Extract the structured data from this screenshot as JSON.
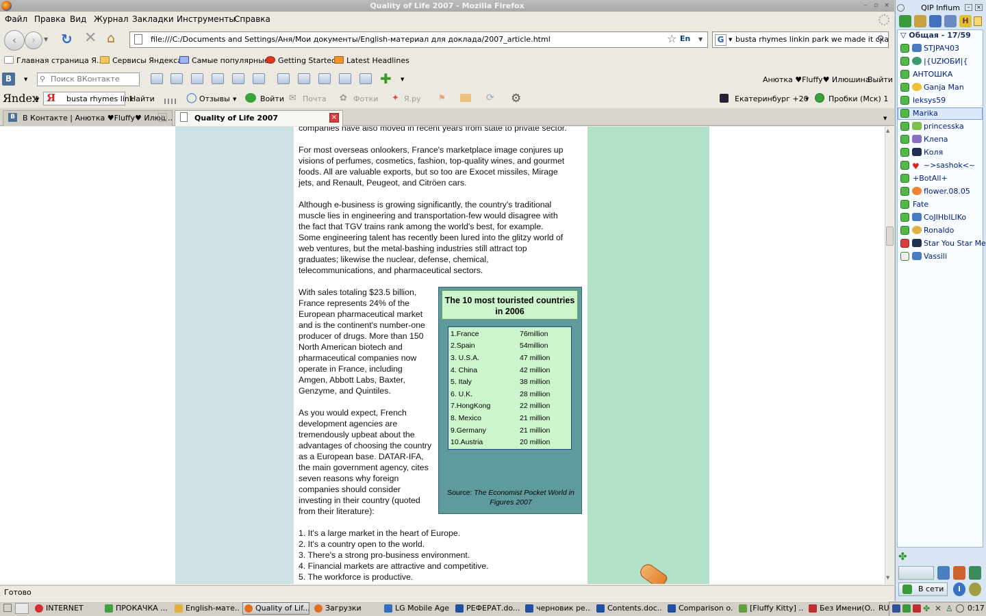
{
  "window": {
    "title": "Quality of Life 2007 - Mozilla Firefox"
  },
  "menu": [
    "Файл",
    "Правка",
    "Вид",
    "Журнал",
    "Закладки",
    "Инструменты",
    "Справка"
  ],
  "nav": {
    "url": "file:///C:/Documents and Settings/Аня/Мои документы/English-материал для доклада/2007_article.html",
    "lang": "En",
    "search_value": "busta rhymes linkin park we made it скача"
  },
  "bookmarks": [
    "Главная страница Я...",
    "Сервисы Яндекса",
    "Самые популярные",
    "Getting Started",
    "Latest Headlines"
  ],
  "vk": {
    "logo": "B",
    "search_placeholder": "Поиск ВКонтакте",
    "user": "Анютка ♥Fluffy♥ Илюшина",
    "logout": "Выйти"
  },
  "yandex": {
    "logo": "Яndex",
    "query": "busta rhymes link",
    "find": "Найти",
    "reviews": "Отзывы",
    "login": "Войти",
    "mail": "Почта",
    "photos": "Фотки",
    "yaru": "Я.ру",
    "weather": "Екатеринбург +20",
    "traffic": "Пробки (Мск) 1"
  },
  "tabs": [
    {
      "label": "В Контакте | Анютка ♥Fluffy♥ Илюш...",
      "active": false
    },
    {
      "label": "Quality of Life 2007",
      "active": true
    }
  ],
  "article": {
    "p0": [
      "companies have also moved in recent years from state to private sector."
    ],
    "p1": [
      "For most overseas onlookers, France's marketplace image conjures up",
      "visions of perfumes, cosmetics, fashion, top-quality wines, and gourmet",
      "foods. All are valuable exports, but so too are Exocet missiles, Mirage",
      "jets, and Renault, Peugeot, and Citröen cars."
    ],
    "p2": [
      "Although e-business is growing significantly, the country's traditional",
      "muscle lies in engineering and transportation-few would disagree with",
      "the fact that TGV trains rank among the world's best, for example.",
      "Some engineering talent has recently been lured into the glitzy world of",
      "web ventures, but the metal-bashing industries still attract top",
      "graduates; likewise the nuclear, defense, chemical,",
      "telecommunications, and pharmaceutical sectors."
    ],
    "p3": [
      "With sales totaling $23.5 billion,",
      "France represents 24% of the",
      "European pharmaceutical market",
      "and is the continent's number-one",
      "producer of drugs. More than 150",
      "North American biotech and",
      "pharmaceutical companies now",
      "operate in France, including",
      "Amgen, Abbott Labs, Baxter,",
      "Genzyme, and Quintiles."
    ],
    "p4": [
      "As you would expect, French",
      "development agencies are",
      "tremendously upbeat about the",
      "advantages of choosing the country",
      "as a European base. DATAR-IFA,",
      "the main government agency, cites",
      "seven reasons why foreign",
      "companies should consider",
      "investing in their country (quoted",
      "from their literature):"
    ],
    "p5": [
      "1. It's a large market in the heart of Europe.",
      "2. It's a country open to the world.",
      "3. There's a strong pro-business environment.",
      "4. Financial markets are attractive and competitive.",
      "5. The workforce is productive."
    ]
  },
  "sidebar_box": {
    "title": "The 10 most touristed countries in 2006",
    "rows": [
      [
        "1.France",
        "76million"
      ],
      [
        "2.Spain",
        "54million"
      ],
      [
        "3. U.S.A.",
        "47 million"
      ],
      [
        "4. China",
        "42 million"
      ],
      [
        "5. Italy",
        "38 million"
      ],
      [
        "6. U.K.",
        "28 million"
      ],
      [
        "7.HongKong",
        "22 million"
      ],
      [
        "8. Mexico",
        "21 million"
      ],
      [
        "9.Germany",
        "21 million"
      ],
      [
        "10.Austria",
        "20 million"
      ]
    ],
    "source_prefix": "Source: ",
    "source_title": "The Economist Pocket World in Figures 2007"
  },
  "status": "Готово",
  "taskbar": {
    "items": [
      {
        "label": "INTERNET",
        "color": "#d03030"
      },
      {
        "label": "ПРОКАЧКА ...",
        "color": "#40a040"
      },
      {
        "label": "English-мате...",
        "color": "#e0b040"
      },
      {
        "label": "Quality of Lif...",
        "color": "#e07020"
      },
      {
        "label": "Загрузки",
        "color": "#e07020"
      },
      {
        "label": "LG Mobile Agent",
        "color": "#3070c0"
      },
      {
        "label": "РЕФЕРАТ.do...",
        "color": "#2050a0"
      },
      {
        "label": "черновик ре...",
        "color": "#2050a0"
      },
      {
        "label": "Contents.doc...",
        "color": "#2050a0"
      },
      {
        "label": "Comparison o...",
        "color": "#2050a0"
      },
      {
        "label": "[Fluffy Kitty] ...",
        "color": "#60a040"
      },
      {
        "label": "Без Имени(O...",
        "color": "#c03030"
      }
    ],
    "lang": "RU",
    "clock": "0:17"
  },
  "qip": {
    "title": "QIP Infium",
    "group": "Общая - 17/59",
    "contacts": [
      "STJPAЧ03",
      "|{UZЮБИ|{",
      "АНТОШКА",
      "Ganja Man",
      "leksys59",
      "Marika",
      "princesska",
      "Клепа",
      "Коля",
      "~>sashok<~",
      "+BotAll+",
      "flower.08.05",
      "Fate",
      "СоJIHbILIKo",
      "Ronaldo",
      "Star You Star Me",
      "Vassili"
    ],
    "status_label": "В сети"
  }
}
